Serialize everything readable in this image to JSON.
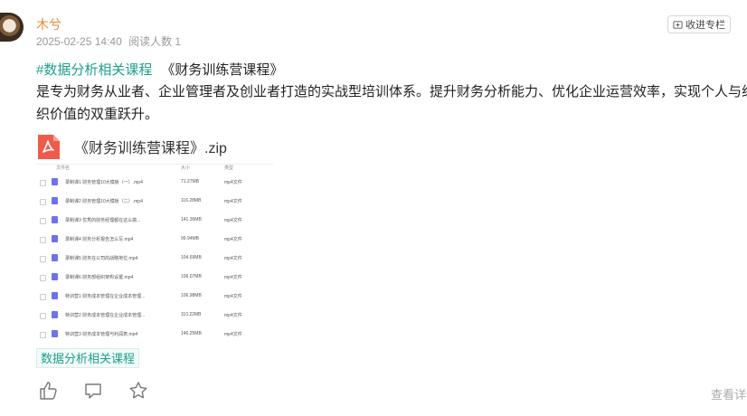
{
  "author": {
    "name": "木兮"
  },
  "meta": {
    "date": "2025-02-25 14:40",
    "reads": "阅读人数 1"
  },
  "header": {
    "collect_label": "收进专栏"
  },
  "post": {
    "hashtag": "#数据分析相关课程",
    "course": "《财务训练营课程》",
    "description": "是专为财务从业者、企业管理者及创业者打造的实战型培训体系。提升财务分析能力、优化企业运营效率，实现个人与组织价值的双重跃升。"
  },
  "attachment": {
    "name": "《财务训练营课程》.zip",
    "icon": "pdf-file-icon"
  },
  "file_list": {
    "headers": {
      "name": "文件名",
      "size": "大小",
      "type": "类型"
    },
    "rows": [
      {
        "name": "录制课1 财务管理10大模板（一）.mp4",
        "size": "71.27MB",
        "type": "mp4文件"
      },
      {
        "name": "录制课2 财务管理10大模板（二）.mp4",
        "size": "116.28MB",
        "type": "mp4文件"
      },
      {
        "name": "录制课3 优秀的财务经理都在这么搞...",
        "size": "141.36MB",
        "type": "mp4文件"
      },
      {
        "name": "录制课4 财务分析报告怎么写.mp4",
        "size": "99.94MB",
        "type": "mp4文件"
      },
      {
        "name": "录制课5 财务在公司的战略地位.mp4",
        "size": "104.69MB",
        "type": "mp4文件"
      },
      {
        "name": "录制课6 财务部组织架构设置.mp4",
        "size": "106.07MB",
        "type": "mp4文件"
      },
      {
        "name": "特训营1 财务成本管理在企业成本管理...",
        "size": "106.98MB",
        "type": "mp4文件"
      },
      {
        "name": "特训营2 财务成本管理在企业成本管理...",
        "size": "110.22MB",
        "type": "mp4文件"
      },
      {
        "name": "特训营3 财务成本管理与利润表.mp4",
        "size": "146.25MB",
        "type": "mp4文件"
      }
    ]
  },
  "tag": {
    "label": "数据分析相关课程"
  },
  "footer": {
    "more_label": "查看详情"
  },
  "colors": {
    "accent": "#1e9f8b",
    "author": "#e58a3b",
    "pdf": "#f05a4a"
  }
}
